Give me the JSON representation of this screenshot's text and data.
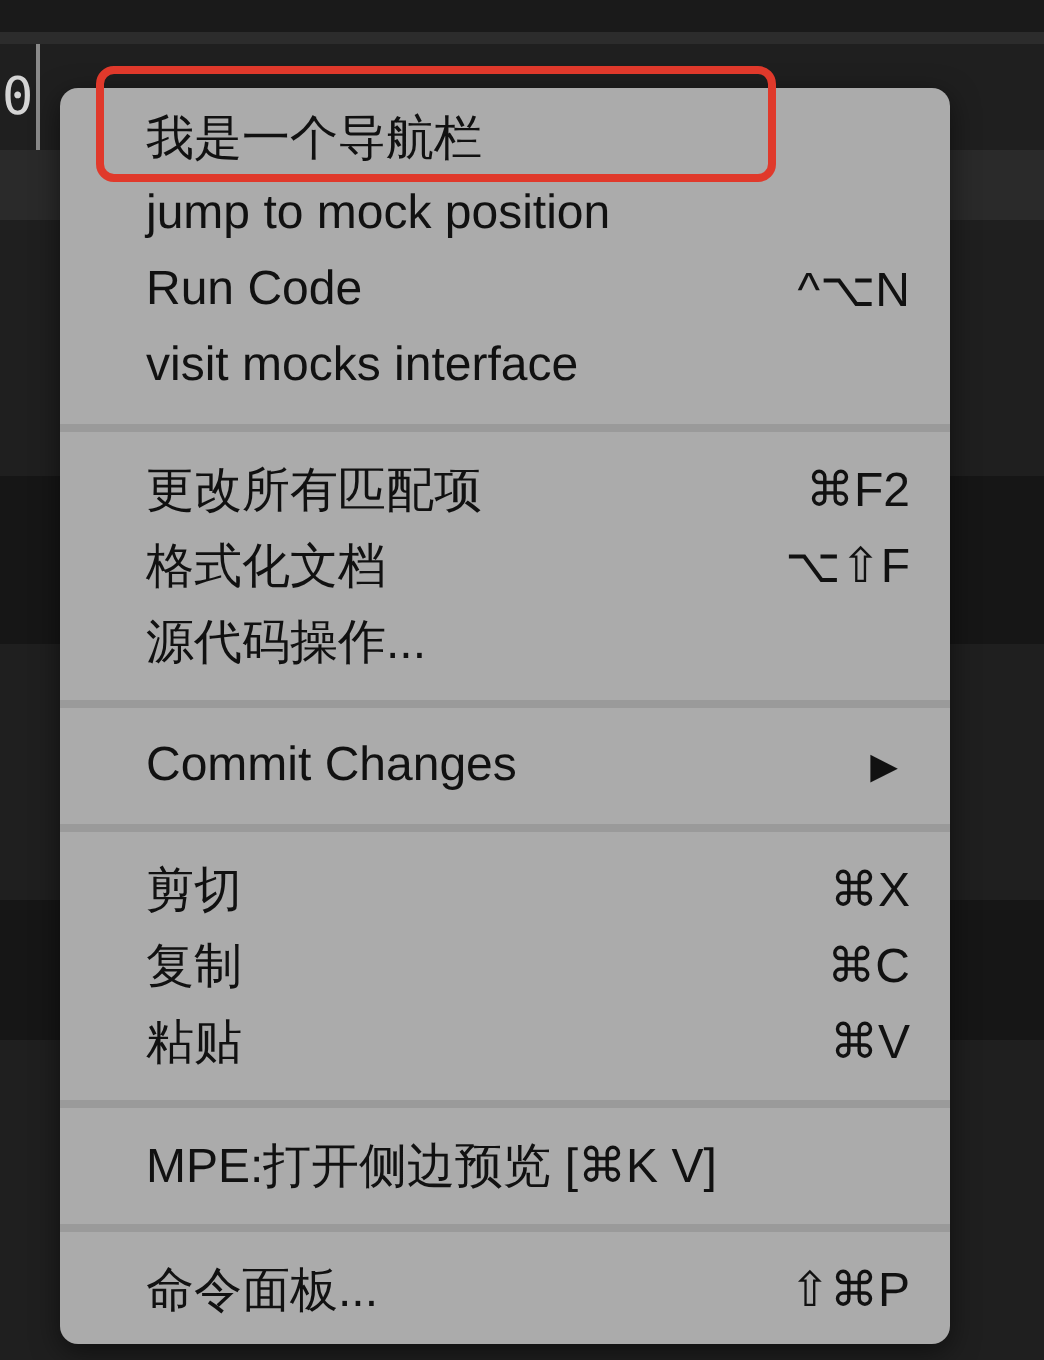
{
  "editor": {
    "line_text": "0"
  },
  "context_menu": {
    "items": [
      {
        "kind": "item",
        "label": "我是一个导航栏",
        "annotated": true
      },
      {
        "kind": "item",
        "label": "jump to mock position",
        "annotated": false
      },
      {
        "kind": "item",
        "label": "Run Code",
        "shortcut": "^⌥N",
        "annotated": false
      },
      {
        "kind": "item",
        "label": "visit mocks interface",
        "annotated": false
      },
      {
        "kind": "separator"
      },
      {
        "kind": "item",
        "label": "更改所有匹配项",
        "shortcut": "⌘F2",
        "annotated": false
      },
      {
        "kind": "item",
        "label": "格式化文档",
        "shortcut": "⌥⇧F",
        "annotated": false
      },
      {
        "kind": "item",
        "label": "源代码操作...",
        "annotated": false
      },
      {
        "kind": "separator"
      },
      {
        "kind": "submenu",
        "label": "Commit Changes",
        "arrow": "▶",
        "annotated": false
      },
      {
        "kind": "separator"
      },
      {
        "kind": "item",
        "label": "剪切",
        "shortcut": "⌘X",
        "annotated": false
      },
      {
        "kind": "item",
        "label": "复制",
        "shortcut": "⌘C",
        "annotated": false
      },
      {
        "kind": "item",
        "label": "粘贴",
        "shortcut": "⌘V",
        "annotated": false
      },
      {
        "kind": "separator"
      },
      {
        "kind": "item",
        "label": "MPE:打开侧边预览 [⌘K V]",
        "annotated": false
      },
      {
        "kind": "separator"
      },
      {
        "kind": "item",
        "label": "命令面板...",
        "shortcut": "⇧⌘P",
        "annotated": false
      }
    ]
  }
}
